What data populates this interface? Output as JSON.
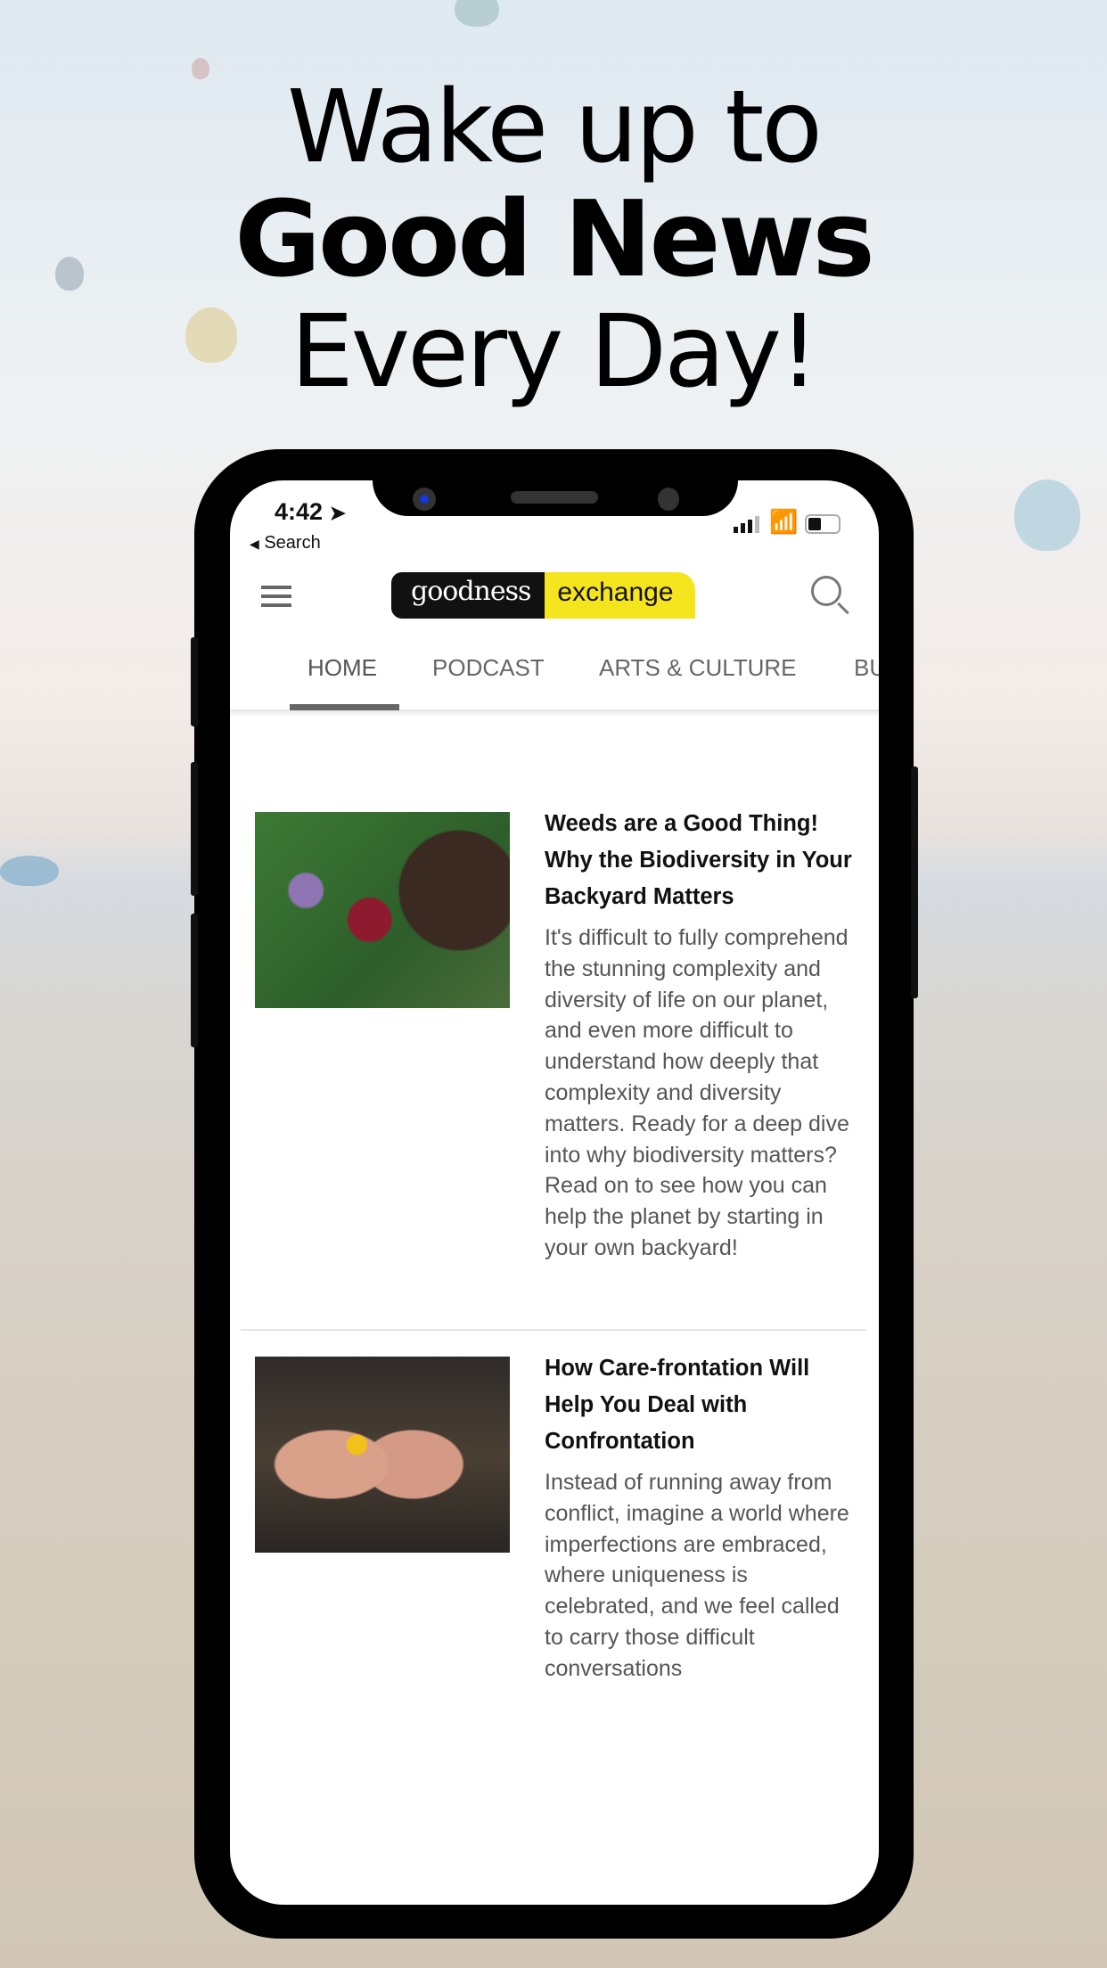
{
  "promo": {
    "line1": "Wake up to",
    "line2": "Good News",
    "line3": "Every Day!"
  },
  "status": {
    "time": "4:42",
    "back_label": "Search",
    "icons": [
      "location-arrow-icon",
      "signal-icon",
      "wifi-icon",
      "battery-icon"
    ]
  },
  "header": {
    "logo_left": "goodness",
    "logo_right": "exchange",
    "logo_colors": {
      "dark": "#111111",
      "yellow": "#f5e51e"
    },
    "menu_icon": "hamburger-icon",
    "search_icon": "search-icon"
  },
  "tabs": [
    {
      "label": "HOME",
      "active": true
    },
    {
      "label": "PODCAST"
    },
    {
      "label": "ARTS & CULTURE"
    },
    {
      "label": "BU"
    }
  ],
  "articles": [
    {
      "title": "Weeds are a Good Thing! Why the Biodiversity in Your Backyard Matters",
      "excerpt": "It's difficult to fully comprehend the stunning complexity and diversity of life on our planet, and even more difficult to understand how deeply that complexity and diversity matters. Ready for a deep dive into why biodiversity matters? Read on to see how you can help the planet by starting in your own backyard!"
    },
    {
      "title": "How Care-frontation Will Help You Deal with Confrontation",
      "excerpt": "Instead of running away from conflict, imagine a world where imperfections are embraced, where uniqueness is celebrated, and we feel called to carry those difficult conversations"
    }
  ]
}
